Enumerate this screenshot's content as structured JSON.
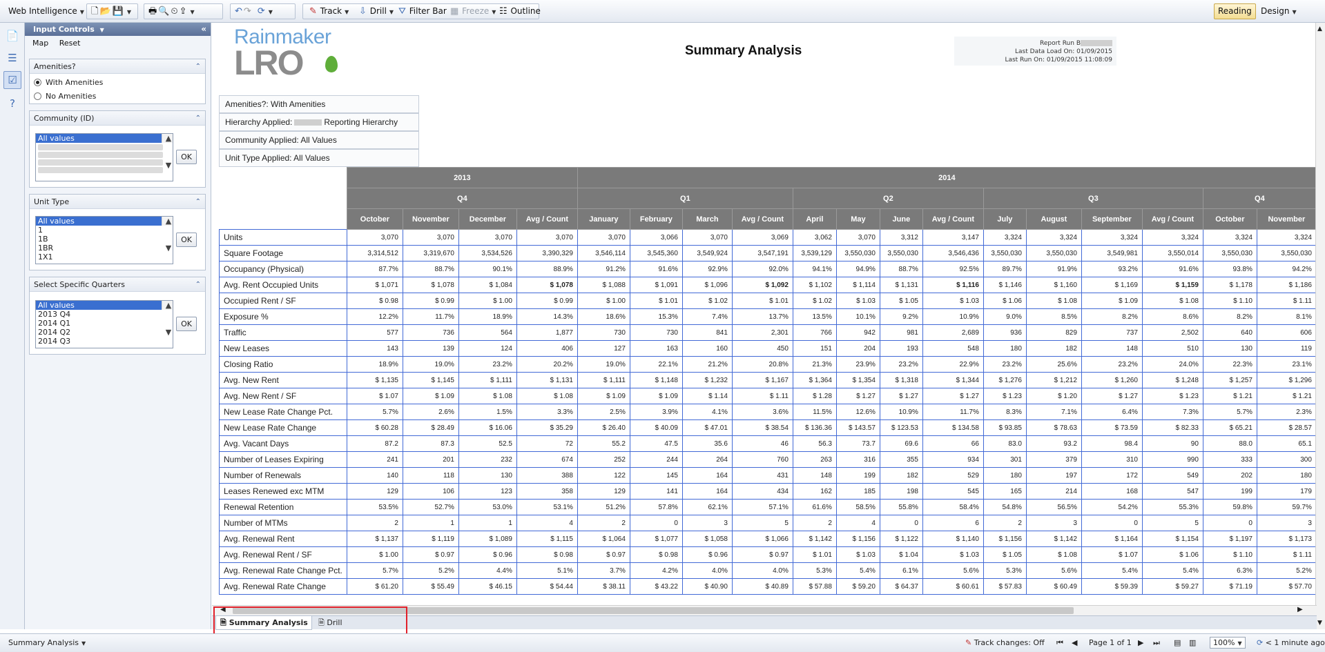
{
  "toolbar": {
    "app_menu": "Web Intelligence",
    "track": "Track",
    "drill": "Drill",
    "filter_bar": "Filter Bar",
    "freeze": "Freeze",
    "outline": "Outline",
    "reading": "Reading",
    "design": "Design"
  },
  "panel": {
    "title": "Input Controls",
    "map": "Map",
    "reset": "Reset",
    "ok": "OK",
    "amenities": {
      "title": "Amenities?",
      "options": [
        "With Amenities",
        "No Amenities"
      ]
    },
    "community": {
      "title": "Community (ID)",
      "items": [
        "All values"
      ]
    },
    "unit_type": {
      "title": "Unit Type",
      "items": [
        "All values",
        "1",
        "1B",
        "1BR",
        "1X1"
      ]
    },
    "quarters": {
      "title": "Select Specific Quarters",
      "items": [
        "All values",
        "2013 Q4",
        "2014 Q1",
        "2014 Q2",
        "2014 Q3"
      ]
    }
  },
  "report": {
    "logo_top": "Rainmaker",
    "logo_bottom": "LRO",
    "title": "Summary Analysis",
    "run_by": "Report Run B",
    "last_data_load": "Last Data Load On: 01/09/2015",
    "last_run": "Last Run On: 01/09/2015 11:08:09",
    "filters": {
      "amenities": "Amenities?:  With Amenities",
      "hierarchy_prefix": "Hierarchy Applied:",
      "hierarchy_suffix": "Reporting Hierarchy",
      "community": "Community Applied: All Values",
      "unit_type": "Unit Type Applied: All Values"
    },
    "years": [
      "2013",
      "2014"
    ],
    "quarters": [
      "Q4",
      "Q1",
      "Q2",
      "Q3",
      "Q4"
    ],
    "months": [
      "October",
      "November",
      "December",
      "Avg / Count",
      "January",
      "February",
      "March",
      "Avg / Count",
      "April",
      "May",
      "June",
      "Avg / Count",
      "July",
      "August",
      "September",
      "Avg / Count",
      "October",
      "November"
    ],
    "rows": [
      {
        "label": "Units",
        "values": [
          "3,070",
          "3,070",
          "3,070",
          "3,070",
          "3,070",
          "3,066",
          "3,070",
          "3,069",
          "3,062",
          "3,070",
          "3,312",
          "3,147",
          "3,324",
          "3,324",
          "3,324",
          "3,324",
          "3,324",
          "3,324"
        ]
      },
      {
        "label": "Square Footage",
        "values": [
          "3,314,512",
          "3,319,670",
          "3,534,526",
          "3,390,329",
          "3,546,114",
          "3,545,360",
          "3,549,924",
          "3,547,191",
          "3,539,129",
          "3,550,030",
          "3,550,030",
          "3,546,436",
          "3,550,030",
          "3,550,030",
          "3,549,981",
          "3,550,014",
          "3,550,030",
          "3,550,030"
        ]
      },
      {
        "label": "Occupancy (Physical)",
        "values": [
          "87.7%",
          "88.7%",
          "90.1%",
          "88.9%",
          "91.2%",
          "91.6%",
          "92.9%",
          "92.0%",
          "94.1%",
          "94.9%",
          "88.7%",
          "92.5%",
          "89.7%",
          "91.9%",
          "93.2%",
          "91.6%",
          "93.8%",
          "94.2%"
        ]
      },
      {
        "label": "Avg. Rent Occupied Units",
        "values": [
          "$ 1,071",
          "$ 1,078",
          "$ 1,084",
          "$ 1,078",
          "$ 1,088",
          "$ 1,091",
          "$ 1,096",
          "$ 1,092",
          "$ 1,102",
          "$ 1,114",
          "$ 1,131",
          "$ 1,116",
          "$ 1,146",
          "$ 1,160",
          "$ 1,169",
          "$ 1,159",
          "$ 1,178",
          "$ 1,186"
        ]
      },
      {
        "label": "Occupied Rent / SF",
        "values": [
          "$ 0.98",
          "$ 0.99",
          "$ 1.00",
          "$ 0.99",
          "$ 1.00",
          "$ 1.01",
          "$ 1.02",
          "$ 1.01",
          "$ 1.02",
          "$ 1.03",
          "$ 1.05",
          "$ 1.03",
          "$ 1.06",
          "$ 1.08",
          "$ 1.09",
          "$ 1.08",
          "$ 1.10",
          "$ 1.11"
        ]
      },
      {
        "label": "Exposure %",
        "values": [
          "12.2%",
          "11.7%",
          "18.9%",
          "14.3%",
          "18.6%",
          "15.3%",
          "7.4%",
          "13.7%",
          "13.5%",
          "10.1%",
          "9.2%",
          "10.9%",
          "9.0%",
          "8.5%",
          "8.2%",
          "8.6%",
          "8.2%",
          "8.1%"
        ]
      },
      {
        "label": "Traffic",
        "values": [
          "577",
          "736",
          "564",
          "1,877",
          "730",
          "730",
          "841",
          "2,301",
          "766",
          "942",
          "981",
          "2,689",
          "936",
          "829",
          "737",
          "2,502",
          "640",
          "606"
        ]
      },
      {
        "label": "New Leases",
        "values": [
          "143",
          "139",
          "124",
          "406",
          "127",
          "163",
          "160",
          "450",
          "151",
          "204",
          "193",
          "548",
          "180",
          "182",
          "148",
          "510",
          "130",
          "119"
        ]
      },
      {
        "label": "Closing Ratio",
        "values": [
          "18.9%",
          "19.0%",
          "23.2%",
          "20.2%",
          "19.0%",
          "22.1%",
          "21.2%",
          "20.8%",
          "21.3%",
          "23.9%",
          "23.2%",
          "22.9%",
          "23.2%",
          "25.6%",
          "23.2%",
          "24.0%",
          "22.3%",
          "23.1%"
        ]
      },
      {
        "label": "Avg. New Rent",
        "values": [
          "$ 1,135",
          "$ 1,145",
          "$ 1,111",
          "$ 1,131",
          "$ 1,111",
          "$ 1,148",
          "$ 1,232",
          "$ 1,167",
          "$ 1,364",
          "$ 1,354",
          "$ 1,318",
          "$ 1,344",
          "$ 1,276",
          "$ 1,212",
          "$ 1,260",
          "$ 1,248",
          "$ 1,257",
          "$ 1,296"
        ]
      },
      {
        "label": "Avg. New Rent / SF",
        "values": [
          "$ 1.07",
          "$ 1.09",
          "$ 1.08",
          "$ 1.08",
          "$ 1.09",
          "$ 1.09",
          "$ 1.14",
          "$ 1.11",
          "$ 1.28",
          "$ 1.27",
          "$ 1.27",
          "$ 1.27",
          "$ 1.23",
          "$ 1.20",
          "$ 1.27",
          "$ 1.23",
          "$ 1.21",
          "$ 1.21"
        ]
      },
      {
        "label": "New Lease Rate Change Pct.",
        "values": [
          "5.7%",
          "2.6%",
          "1.5%",
          "3.3%",
          "2.5%",
          "3.9%",
          "4.1%",
          "3.6%",
          "11.5%",
          "12.6%",
          "10.9%",
          "11.7%",
          "8.3%",
          "7.1%",
          "6.4%",
          "7.3%",
          "5.7%",
          "2.3%"
        ]
      },
      {
        "label": "New Lease Rate Change",
        "values": [
          "$ 60.28",
          "$ 28.49",
          "$ 16.06",
          "$ 35.29",
          "$ 26.40",
          "$ 40.09",
          "$ 47.01",
          "$ 38.54",
          "$ 136.36",
          "$ 143.57",
          "$ 123.53",
          "$ 134.58",
          "$ 93.85",
          "$ 78.63",
          "$ 73.59",
          "$ 82.33",
          "$ 65.21",
          "$ 28.57"
        ]
      },
      {
        "label": "Avg. Vacant Days",
        "values": [
          "87.2",
          "87.3",
          "52.5",
          "72",
          "55.2",
          "47.5",
          "35.6",
          "46",
          "56.3",
          "73.7",
          "69.6",
          "66",
          "83.0",
          "93.2",
          "98.4",
          "90",
          "88.0",
          "65.1"
        ]
      },
      {
        "label": "Number of Leases Expiring",
        "values": [
          "241",
          "201",
          "232",
          "674",
          "252",
          "244",
          "264",
          "760",
          "263",
          "316",
          "355",
          "934",
          "301",
          "379",
          "310",
          "990",
          "333",
          "300"
        ]
      },
      {
        "label": "Number of Renewals",
        "values": [
          "140",
          "118",
          "130",
          "388",
          "122",
          "145",
          "164",
          "431",
          "148",
          "199",
          "182",
          "529",
          "180",
          "197",
          "172",
          "549",
          "202",
          "180"
        ]
      },
      {
        "label": "Leases Renewed exc MTM",
        "values": [
          "129",
          "106",
          "123",
          "358",
          "129",
          "141",
          "164",
          "434",
          "162",
          "185",
          "198",
          "545",
          "165",
          "214",
          "168",
          "547",
          "199",
          "179"
        ]
      },
      {
        "label": "Renewal Retention",
        "values": [
          "53.5%",
          "52.7%",
          "53.0%",
          "53.1%",
          "51.2%",
          "57.8%",
          "62.1%",
          "57.1%",
          "61.6%",
          "58.5%",
          "55.8%",
          "58.4%",
          "54.8%",
          "56.5%",
          "54.2%",
          "55.3%",
          "59.8%",
          "59.7%"
        ]
      },
      {
        "label": "Number of MTMs",
        "values": [
          "2",
          "1",
          "1",
          "4",
          "2",
          "0",
          "3",
          "5",
          "2",
          "4",
          "0",
          "6",
          "2",
          "3",
          "0",
          "5",
          "0",
          "3"
        ]
      },
      {
        "label": "Avg. Renewal Rent",
        "values": [
          "$ 1,137",
          "$ 1,119",
          "$ 1,089",
          "$ 1,115",
          "$ 1,064",
          "$ 1,077",
          "$ 1,058",
          "$ 1,066",
          "$ 1,142",
          "$ 1,156",
          "$ 1,122",
          "$ 1,140",
          "$ 1,156",
          "$ 1,142",
          "$ 1,164",
          "$ 1,154",
          "$ 1,197",
          "$ 1,173"
        ]
      },
      {
        "label": "Avg. Renewal Rent / SF",
        "values": [
          "$ 1.00",
          "$ 0.97",
          "$ 0.96",
          "$ 0.98",
          "$ 0.97",
          "$ 0.98",
          "$ 0.96",
          "$ 0.97",
          "$ 1.01",
          "$ 1.03",
          "$ 1.04",
          "$ 1.03",
          "$ 1.05",
          "$ 1.08",
          "$ 1.07",
          "$ 1.06",
          "$ 1.10",
          "$ 1.11"
        ]
      },
      {
        "label": "Avg. Renewal Rate Change Pct.",
        "values": [
          "5.7%",
          "5.2%",
          "4.4%",
          "5.1%",
          "3.7%",
          "4.2%",
          "4.0%",
          "4.0%",
          "5.3%",
          "5.4%",
          "6.1%",
          "5.6%",
          "5.3%",
          "5.6%",
          "5.4%",
          "5.4%",
          "6.3%",
          "5.2%"
        ]
      },
      {
        "label": "Avg. Renewal Rate Change",
        "values": [
          "$ 61.20",
          "$ 55.49",
          "$ 46.15",
          "$ 54.44",
          "$ 38.11",
          "$ 43.22",
          "$ 40.90",
          "$ 40.89",
          "$ 57.88",
          "$ 59.20",
          "$ 64.37",
          "$ 60.61",
          "$ 57.83",
          "$ 60.49",
          "$ 59.39",
          "$ 59.27",
          "$ 71.19",
          "$ 57.70"
        ]
      }
    ]
  },
  "tabs": [
    "Summary Analysis",
    "Drill"
  ],
  "status": {
    "section": "Summary Analysis",
    "track": "Track changes: Off",
    "page": "Page 1 of 1",
    "zoom": "100%",
    "refresh": "< 1 minute ago"
  }
}
